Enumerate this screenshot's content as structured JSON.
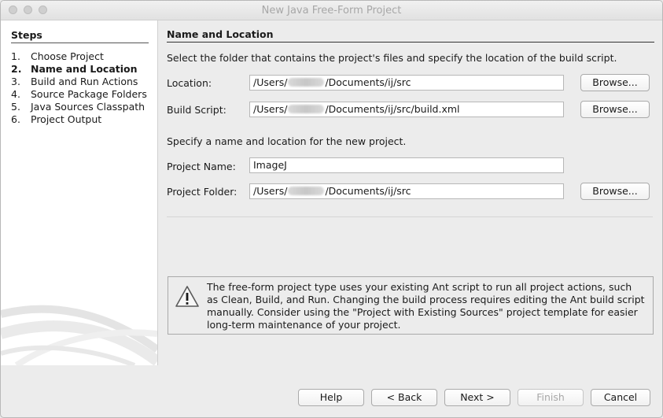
{
  "window": {
    "title": "New Java Free-Form Project"
  },
  "steps": {
    "heading": "Steps",
    "items": [
      {
        "num": "1.",
        "label": "Choose Project"
      },
      {
        "num": "2.",
        "label": "Name and Location"
      },
      {
        "num": "3.",
        "label": "Build and Run Actions"
      },
      {
        "num": "4.",
        "label": "Source Package Folders"
      },
      {
        "num": "5.",
        "label": "Java Sources Classpath"
      },
      {
        "num": "6.",
        "label": "Project Output"
      }
    ]
  },
  "main": {
    "heading": "Name and Location",
    "intro": "Select the folder that contains the project's files and specify the location of the build script.",
    "location": {
      "label": "Location:",
      "prefix": "/Users/",
      "suffix": "/Documents/ij/src",
      "browse": "Browse..."
    },
    "build_script": {
      "label": "Build Script:",
      "prefix": "/Users/",
      "suffix": "/Documents/ij/src/build.xml",
      "browse": "Browse..."
    },
    "project_intro": "Specify a name and location for the new project.",
    "project_name": {
      "label": "Project Name:",
      "value": "ImageJ"
    },
    "project_folder": {
      "label": "Project Folder:",
      "prefix": "/Users/",
      "suffix": "/Documents/ij/src",
      "browse": "Browse..."
    },
    "notice": {
      "icon": "warning-icon",
      "lines": [
        "The free-form project type uses your existing Ant script to run all project actions, such",
        "as Clean, Build, and Run. Changing the build process requires editing the Ant build script",
        "manually. Consider using the \"Project with Existing Sources\" project template for easier",
        "long-term maintenance of your  project."
      ]
    }
  },
  "footer": {
    "help": "Help",
    "back": "< Back",
    "next": "Next >",
    "finish": "Finish",
    "cancel": "Cancel"
  }
}
